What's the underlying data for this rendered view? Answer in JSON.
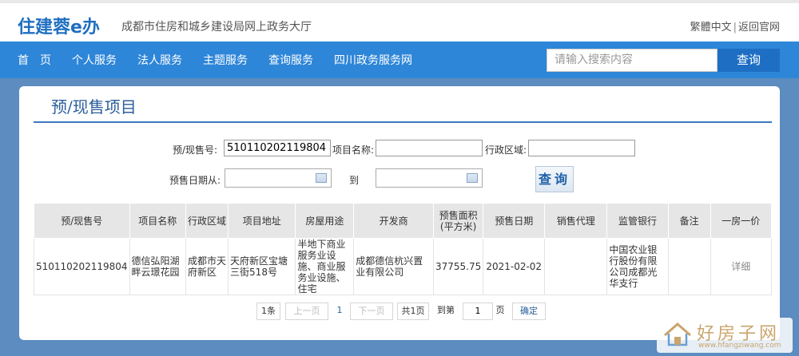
{
  "header": {
    "logo": "住建蓉e办",
    "site_name": "成都市住房和城乡建设局网上政务大厅",
    "lang_link": "繁體中文",
    "separator": "|",
    "back_link": "返回官网"
  },
  "nav": {
    "items": [
      "首页",
      "个人服务",
      "法人服务",
      "主题服务",
      "查询服务",
      "四川政务服务网"
    ],
    "search_placeholder": "请输入搜索内容",
    "search_button": "查询"
  },
  "panel": {
    "title": "预/现售项目"
  },
  "form": {
    "presale_no_label": "预/现售号:",
    "presale_no_value": "510110202119804",
    "project_name_label": "项目名称:",
    "project_name_value": "",
    "district_label": "行政区域:",
    "district_value": "",
    "date_from_label": "预售日期从:",
    "date_to_label": "到",
    "query_button": "查询"
  },
  "table": {
    "headers": [
      "预/现售号",
      "项目名称",
      "行政区域",
      "项目地址",
      "房屋用途",
      "开发商",
      "预售面积(平方米)",
      "预售日期",
      "销售代理",
      "监管银行",
      "备注",
      "一房一价"
    ],
    "header_area_line1": "预售面积",
    "header_area_line2": "(平方米)",
    "rows": [
      {
        "presale_no": "510110202119804",
        "project_name": "德信弘阳湖畔云璟花园",
        "district": "成都市天府新区",
        "address": "天府新区宝塘三街518号",
        "usage": "半地下商业服务业设施、商业服务业设施、住宅",
        "developer": "成都德信杭兴置业有限公司",
        "area": "37755.75",
        "date": "2021-02-02",
        "agent": "",
        "bank": "中国农业银行股份有限公司成都光华支行",
        "remark": "",
        "detail": "详细"
      }
    ]
  },
  "pager": {
    "total": "1条",
    "prev": "上一页",
    "current": "1",
    "next": "下一页",
    "pages": "共1页",
    "goto_label": "到第",
    "goto_value": "1",
    "page_unit": "页",
    "confirm": "确定"
  },
  "watermark": {
    "text": "好房子网",
    "url": "www.hfangziwang.com"
  }
}
